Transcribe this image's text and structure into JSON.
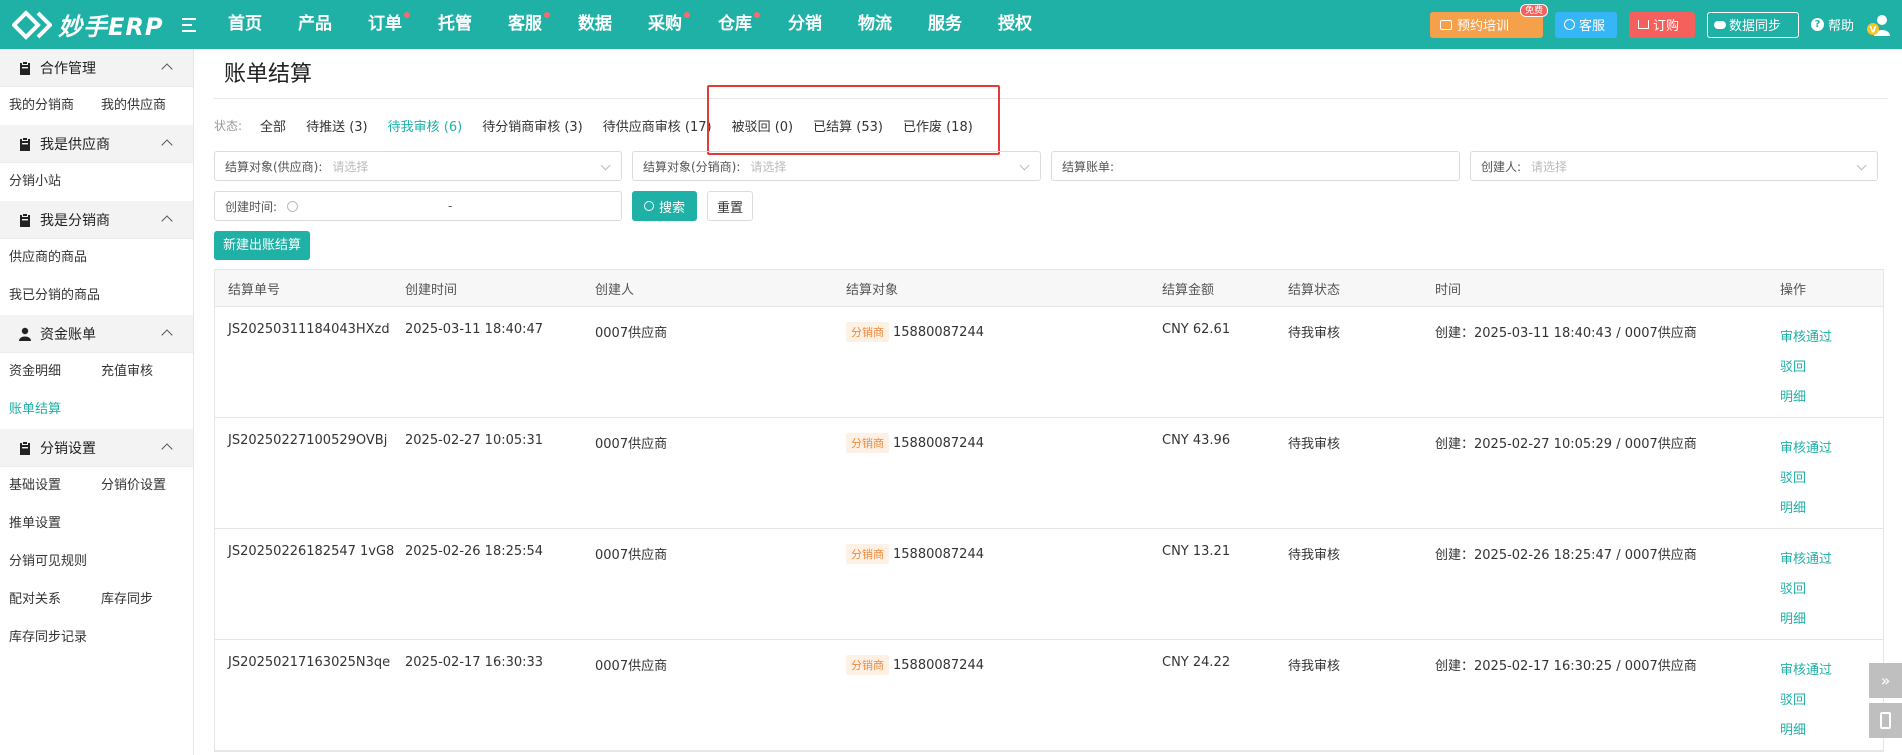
{
  "header": {
    "logo_text": "妙手ERP",
    "nav": [
      {
        "label": "首页",
        "dot": false
      },
      {
        "label": "产品",
        "dot": false
      },
      {
        "label": "订单",
        "dot": true
      },
      {
        "label": "托管",
        "dot": false
      },
      {
        "label": "客服",
        "dot": true
      },
      {
        "label": "数据",
        "dot": false
      },
      {
        "label": "采购",
        "dot": true
      },
      {
        "label": "仓库",
        "dot": true
      },
      {
        "label": "分销",
        "dot": false
      },
      {
        "label": "物流",
        "dot": false
      },
      {
        "label": "服务",
        "dot": false
      },
      {
        "label": "授权",
        "dot": false
      }
    ],
    "train_label": "预约培训",
    "free_badge": "免费",
    "service_label": "客服",
    "order_label": "订购",
    "sync_label": "数据同步",
    "help_label": "帮助",
    "user_initial": "V",
    "colors": {
      "brand": "#1fb0a6",
      "train": "#f5a04a",
      "service": "#37b6f7",
      "order": "#f5605c"
    }
  },
  "sidebar": {
    "sections": [
      {
        "title": "合作管理",
        "icon": "clipboard-icon",
        "items": [
          "我的分销商",
          "我的供应商"
        ]
      },
      {
        "title": "我是供应商",
        "icon": "clipboard-icon",
        "items": [
          "分销小站"
        ]
      },
      {
        "title": "我是分销商",
        "icon": "clipboard-icon",
        "items": [
          "供应商的商品",
          "我已分销的商品"
        ]
      },
      {
        "title": "资金账单",
        "icon": "user-icon",
        "items": [
          "资金明细",
          "充值审核",
          "账单结算"
        ]
      },
      {
        "title": "分销设置",
        "icon": "clipboard-icon",
        "items": [
          "基础设置",
          "分销价设置",
          "推单设置",
          "分销可见规则",
          "配对关系",
          "库存同步",
          "库存同步记录"
        ]
      }
    ]
  },
  "main": {
    "title": "账单结算",
    "status_label": "状态:",
    "status_tabs": [
      "全部",
      "待推送 (3)",
      "待我审核 (6)",
      "待分销商审核 (3)",
      "待供应商审核 (17)",
      "被驳回 (0)",
      "已结算 (53)",
      "已作废 (18)"
    ],
    "filters": {
      "supplier_label": "结算对象(供应商):",
      "distributor_label": "结算对象(分销商):",
      "bill_label": "结算账单:",
      "creator_label": "创建人:",
      "select_placeholder": "请选择",
      "created_label": "创建时间:",
      "date_sep": "-"
    },
    "search_label": "搜索",
    "reset_label": "重置",
    "new_label": "新建出账结算",
    "table": {
      "headers": [
        "结算单号",
        "创建时间",
        "创建人",
        "结算对象",
        "结算金额",
        "结算状态",
        "时间",
        "操作"
      ],
      "rows": [
        {
          "id": "JS20250311184043HXzd",
          "created": "2025-03-11 18:40:47",
          "creator": "0007供应商",
          "tag": "分销商",
          "target": "15880087244",
          "amount": "CNY 62.61",
          "status": "待我审核",
          "time": "创建：2025-03-11 18:40:43 / 0007供应商"
        },
        {
          "id": "JS20250227100529OVBj",
          "created": "2025-02-27 10:05:31",
          "creator": "0007供应商",
          "tag": "分销商",
          "target": "15880087244",
          "amount": "CNY 43.96",
          "status": "待我审核",
          "time": "创建：2025-02-27 10:05:29 / 0007供应商"
        },
        {
          "id": "JS20250226182547 1vG8",
          "created": "2025-02-26 18:25:54",
          "creator": "0007供应商",
          "tag": "分销商",
          "target": "15880087244",
          "amount": "CNY 13.21",
          "status": "待我审核",
          "time": "创建：2025-02-26 18:25:47 / 0007供应商"
        },
        {
          "id": "JS20250217163025N3qe",
          "created": "2025-02-17 16:30:33",
          "creator": "0007供应商",
          "tag": "分销商",
          "target": "15880087244",
          "amount": "CNY 24.22",
          "status": "待我审核",
          "time": "创建：2025-02-17 16:30:25 / 0007供应商"
        }
      ],
      "ops": [
        "审核通过",
        "驳回",
        "明细"
      ]
    }
  }
}
